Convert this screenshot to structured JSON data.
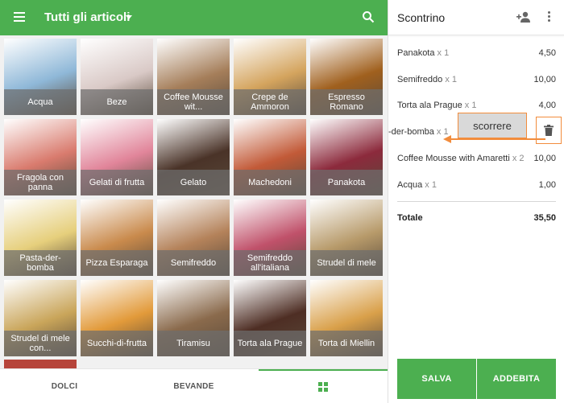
{
  "header": {
    "title": "Tutti gli articoli",
    "menu_icon": "hamburger-menu-icon",
    "search_icon": "search-icon",
    "accent": "#4caf50"
  },
  "products": [
    {
      "label": "Acqua",
      "color": "#8fb8d8"
    },
    {
      "label": "Beze",
      "color": "#d9c9c6"
    },
    {
      "label": "Coffee Mousse wit...",
      "color": "#a57e5a"
    },
    {
      "label": "Crepe de Ammoron",
      "color": "#d4a45e"
    },
    {
      "label": "Espresso Romano",
      "color": "#a0601e"
    },
    {
      "label": "Fragola con panna",
      "color": "#d97b6e"
    },
    {
      "label": "Gelati di frutta",
      "color": "#e1859a"
    },
    {
      "label": "Gelato",
      "color": "#4a3328"
    },
    {
      "label": "Machedoni",
      "color": "#c25a38"
    },
    {
      "label": "Panakota",
      "color": "#8c2a3c"
    },
    {
      "label": "Pasta-der-bomba",
      "color": "#e6cf7c"
    },
    {
      "label": "Pizza Esparaga",
      "color": "#c98a4c"
    },
    {
      "label": "Semifreddo",
      "color": "#b4825a"
    },
    {
      "label": "Semifreddo all'italiana",
      "color": "#c0516a"
    },
    {
      "label": "Strudel di mele",
      "color": "#b79a6a"
    },
    {
      "label": "Strudel di mele con...",
      "color": "#c9a55a"
    },
    {
      "label": "Succhi-di-frutta",
      "color": "#e29a3a"
    },
    {
      "label": "Tiramisu",
      "color": "#8a6a4c"
    },
    {
      "label": "Torta ala Prague",
      "color": "#4e2e24"
    },
    {
      "label": "Torta di Miellin",
      "color": "#d9a04a"
    }
  ],
  "tabs": {
    "dolci": "DOLCI",
    "bevande": "BEVANDE",
    "grid_icon": "grid-view-icon"
  },
  "receipt": {
    "title": "Scontrino",
    "add_customer_icon": "add-person-icon",
    "more_icon": "more-vert-icon",
    "items": [
      {
        "name": "Panakota",
        "qty": "x 1",
        "price": "4,50"
      },
      {
        "name": "Semifreddo",
        "qty": "x 1",
        "price": "10,00"
      },
      {
        "name": "Torta ala Prague",
        "qty": "x 1",
        "price": "4,00"
      },
      {
        "name": "Coffee Mousse with Amaretti",
        "qty": "x 2",
        "price": "10,00"
      },
      {
        "name": "Acqua",
        "qty": "x 1",
        "price": "1,00"
      }
    ],
    "swiped_item": {
      "name": "-der-bomba",
      "qty": "x 1"
    },
    "swipe_hint": "scorrere",
    "delete_icon": "trash-icon",
    "total_label": "Totale",
    "total_value": "35,50",
    "save_label": "SALVA",
    "charge_label": "ADDEBITA"
  }
}
